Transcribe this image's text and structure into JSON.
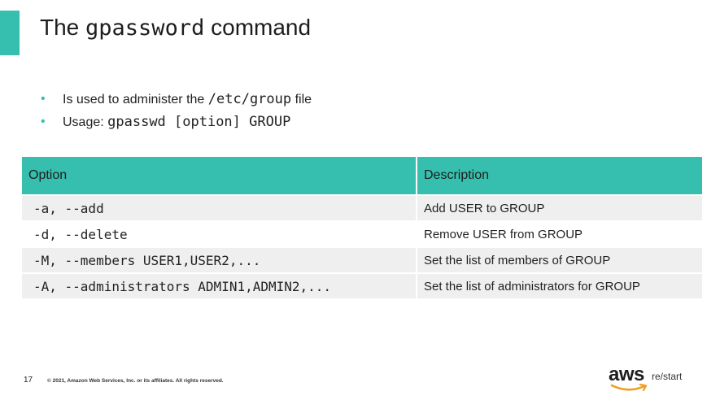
{
  "slide": {
    "title_prefix": "The ",
    "title_command": "gpassword",
    "title_suffix": " command",
    "bullets": [
      {
        "text": "Is used to administer the ",
        "code": "/etc/group",
        "suffix": " file"
      },
      {
        "text": "Usage: ",
        "code": "gpasswd [option] GROUP",
        "suffix": ""
      }
    ],
    "table": {
      "headers": [
        "Option",
        "Description"
      ],
      "rows": [
        {
          "option": "-a, --add",
          "description": "Add USER to GROUP"
        },
        {
          "option": "-d, --delete",
          "description": "Remove USER from GROUP"
        },
        {
          "option": "-M, --members USER1,USER2,...",
          "description": "Set the list of members of GROUP"
        },
        {
          "option": "-A, --administrators ADMIN1,ADMIN2,...",
          "description": "Set the list of administrators for GROUP"
        }
      ]
    },
    "footer": {
      "page_number": "17",
      "copyright": "© 2021, Amazon Web Services, Inc. or its affiliates. All rights reserved.",
      "logo_main": "aws",
      "logo_sub": "re/start"
    },
    "colors": {
      "accent": "#36bfae",
      "row_shade": "#efefef"
    }
  }
}
